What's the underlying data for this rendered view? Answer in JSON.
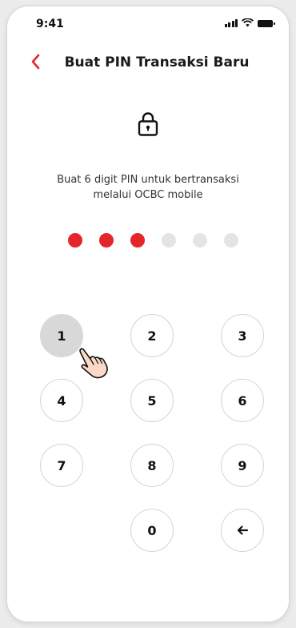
{
  "status_bar": {
    "time": "9:41"
  },
  "header": {
    "title": "Buat PIN Transaksi Baru"
  },
  "instruction": {
    "line1": "Buat 6 digit PIN untuk bertransaksi",
    "line2": "melalui OCBC mobile"
  },
  "pin": {
    "length": 6,
    "entered": 3
  },
  "keypad": {
    "keys": [
      "1",
      "2",
      "3",
      "4",
      "5",
      "6",
      "7",
      "8",
      "9",
      "0"
    ],
    "pressed_key": "1",
    "backspace_icon": "arrow-left-icon"
  },
  "icons": {
    "back": "chevron-left-icon",
    "lock": "lock-icon",
    "pointer": "hand-pointer-icon"
  },
  "colors": {
    "accent": "#e3262a",
    "dot_empty": "#e4e4e4",
    "key_pressed": "#d8d8d8"
  }
}
